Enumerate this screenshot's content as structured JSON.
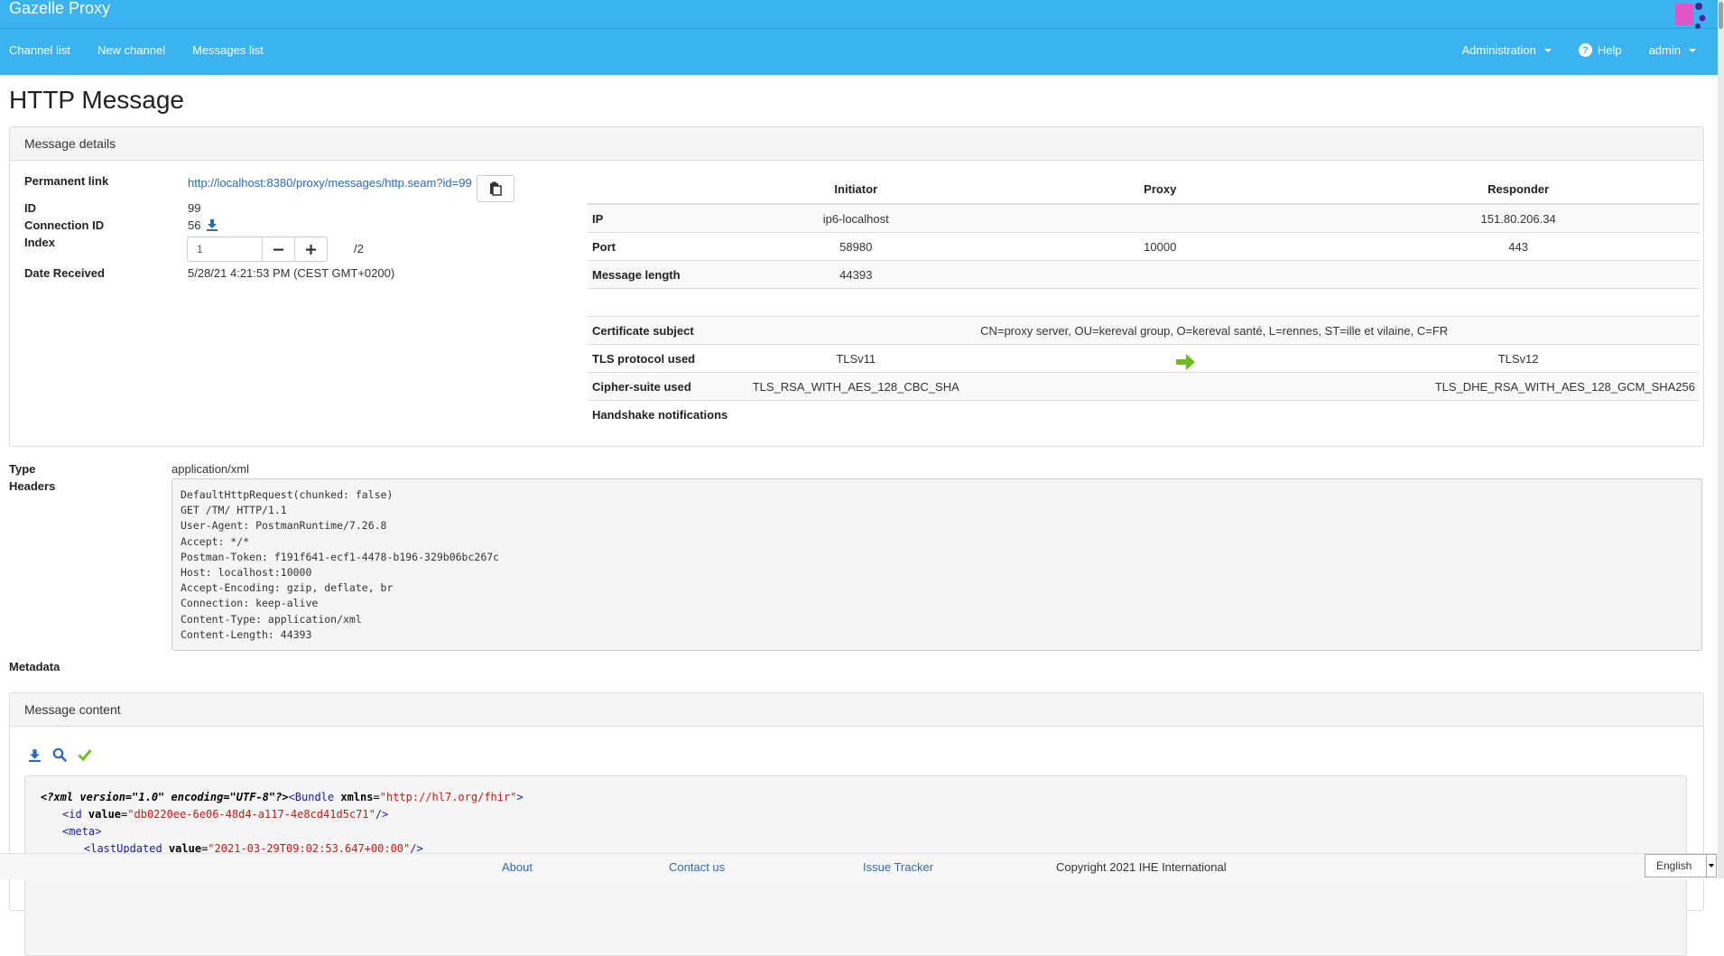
{
  "app": {
    "title": "Gazelle Proxy"
  },
  "nav": {
    "left": [
      "Channel list",
      "New channel",
      "Messages list"
    ],
    "administration": "Administration",
    "help": "Help",
    "user": "admin"
  },
  "page_title": "HTTP Message",
  "details": {
    "heading": "Message details",
    "permanent_link_label": "Permanent link",
    "permanent_link": "http://localhost:8380/proxy/messages/http.seam?id=99",
    "id_label": "ID",
    "id": "99",
    "connection_id_label": "Connection ID",
    "connection_id": "56",
    "index_label": "Index",
    "index_value": "1",
    "index_total": "/2",
    "date_label": "Date Received",
    "date": "5/28/21 4:21:53 PM (CEST GMT+0200)"
  },
  "connection": {
    "headers": {
      "initiator": "Initiator",
      "proxy": "Proxy",
      "responder": "Responder"
    },
    "ip": {
      "label": "IP",
      "initiator": "ip6-localhost",
      "proxy": "",
      "responder": "151.80.206.34"
    },
    "port": {
      "label": "Port",
      "initiator": "58980",
      "proxy": "10000",
      "responder": "443"
    },
    "length": {
      "label": "Message length",
      "initiator": "44393"
    },
    "cert": {
      "label": "Certificate subject",
      "value": "CN=proxy server, OU=kereval group, O=kereval santé, L=rennes, ST=ille et vilaine, C=FR"
    },
    "tls": {
      "label": "TLS protocol used",
      "initiator": "TLSv11",
      "responder": "TLSv12"
    },
    "cipher": {
      "label": "Cipher-suite used",
      "initiator": "TLS_RSA_WITH_AES_128_CBC_SHA",
      "responder": "TLS_DHE_RSA_WITH_AES_128_GCM_SHA256"
    },
    "handshake": {
      "label": "Handshake notifications"
    }
  },
  "message": {
    "type_label": "Type",
    "type": "application/xml",
    "headers_label": "Headers",
    "headers": "DefaultHttpRequest(chunked: false)\nGET /TM/ HTTP/1.1\nUser-Agent: PostmanRuntime/7.26.8\nAccept: */*\nPostman-Token: f191f641-ecf1-4478-b196-329b06bc267c\nHost: localhost:10000\nAccept-Encoding: gzip, deflate, br\nConnection: keep-alive\nContent-Type: application/xml\nContent-Length: 44393",
    "metadata_label": "Metadata"
  },
  "content": {
    "heading": "Message content",
    "xml": {
      "pi": "<?xml version=\"1.0\" encoding=\"UTF-8\"?>",
      "bundle_open": "<Bundle",
      "bundle_attr": " xmlns",
      "bundle_eq": "=",
      "bundle_val": "\"http://hl7.org/fhir\"",
      "bundle_close": ">",
      "id_open": "<id",
      "id_attr": " value",
      "id_eq": "=",
      "id_val": "\"db0220ee-6e06-48d4-a117-4e8cd41d5c71\"",
      "id_close": "/>",
      "meta_open": "<meta>",
      "lu_open": "<lastUpdated",
      "lu_attr": " value",
      "lu_eq": "=",
      "lu_val": "\"2021-03-29T09:02:53.647+00:00\"",
      "lu_close": "/>"
    }
  },
  "footer": {
    "about": "About",
    "contact": "Contact us",
    "tracker": "Issue Tracker",
    "copyright": "Copyright 2021 IHE International",
    "language": "English"
  },
  "colors": {
    "topbar": "#3ab3f0",
    "link": "#2a6ab8",
    "arrow": "#6cbf1a",
    "xml_tag": "#1a1aa6",
    "xml_value": "#c41a16"
  }
}
